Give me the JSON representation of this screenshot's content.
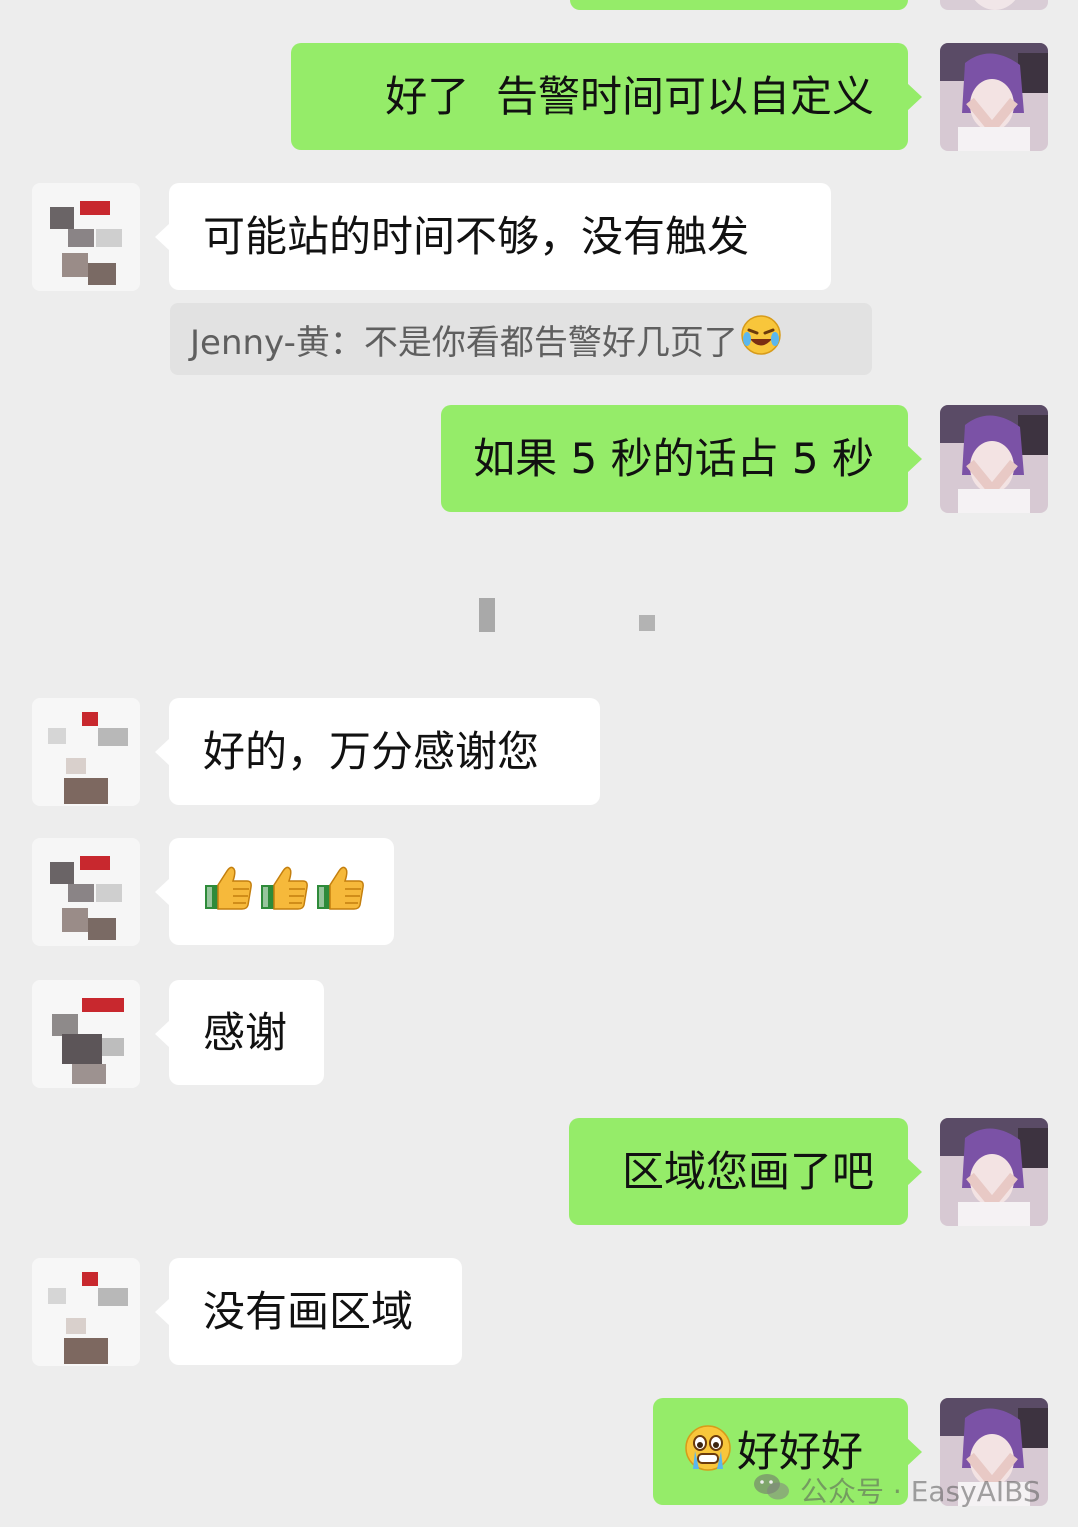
{
  "messages": [
    {
      "id": "m1",
      "side": "out",
      "text": "好了  告警时间可以自定义"
    },
    {
      "id": "m2",
      "side": "in",
      "text": "可能站的时间不够，没有触发"
    },
    {
      "id": "m3",
      "side": "out",
      "text": "如果 5 秒的话占 5 秒"
    },
    {
      "id": "m4",
      "side": "in",
      "text": "好的，万分感谢您"
    },
    {
      "id": "m5",
      "side": "in",
      "emoji": [
        "thumbs-up",
        "thumbs-up",
        "thumbs-up"
      ]
    },
    {
      "id": "m6",
      "side": "in",
      "text": "感谢"
    },
    {
      "id": "m7",
      "side": "out",
      "text": "区域您画了吧"
    },
    {
      "id": "m8",
      "side": "in",
      "text": "没有画区域"
    },
    {
      "id": "m9",
      "side": "out",
      "emoji_prefix": "crying-face",
      "text": "好好好"
    }
  ],
  "quote": {
    "text": "Jenny-黄：不是你看都告警好几页了",
    "emoji": "laughing-crying-face"
  },
  "watermark": {
    "label": "公众号 · EasyAIBS",
    "icon": "wechat-icon"
  },
  "colors": {
    "background": "#ededed",
    "outgoing_bubble": "#95ec69",
    "incoming_bubble": "#ffffff",
    "quote_bubble": "#e2e2e2"
  }
}
